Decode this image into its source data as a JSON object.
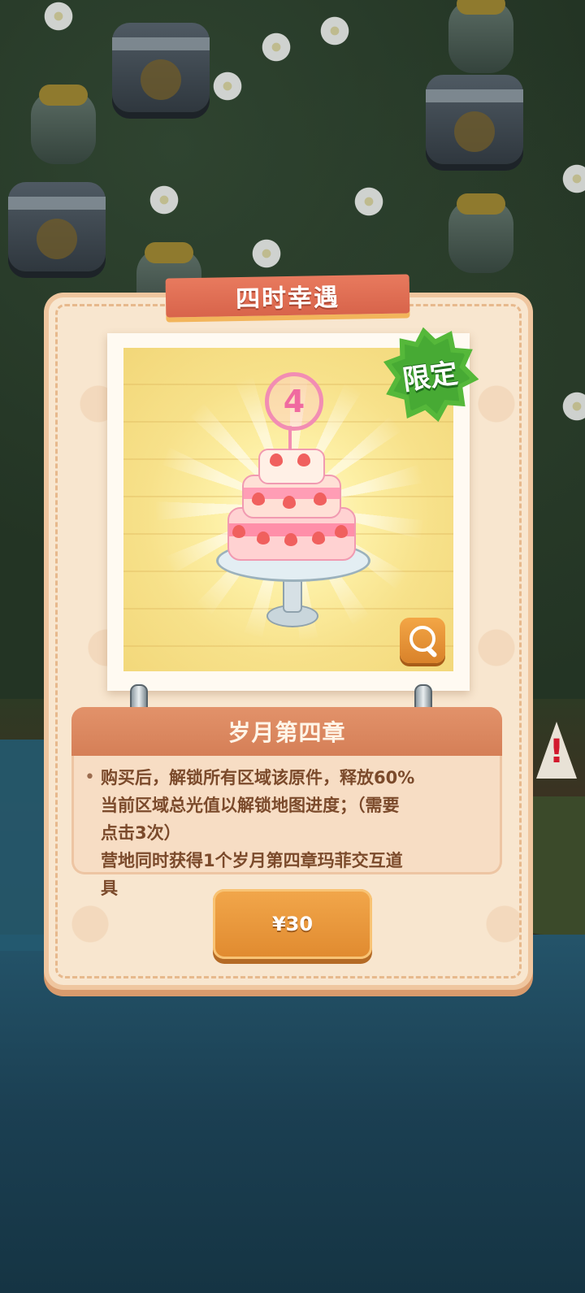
{
  "modal": {
    "title": "四时幸遇",
    "badge": "限定",
    "cake_topper_number": "4",
    "item_name": "岁月第四章",
    "bullet": "•",
    "description_lines": [
      "购买后，解锁所有区域该原件，释放60%",
      "当前区域总光值以解锁地图进度；（需要",
      "点击3次）",
      "营地同时获得1个岁月第四章玛菲交互道",
      "具"
    ],
    "price_label": "¥30"
  },
  "background": {
    "warning_symbol": "!"
  },
  "icons": {
    "zoom": "magnifier-icon",
    "warning": "warning-icon"
  },
  "colors": {
    "accent": "#e08a2f",
    "ribbon": "#d8644b",
    "badge_green": "#55b83a",
    "panel": "#f8e6cf"
  }
}
